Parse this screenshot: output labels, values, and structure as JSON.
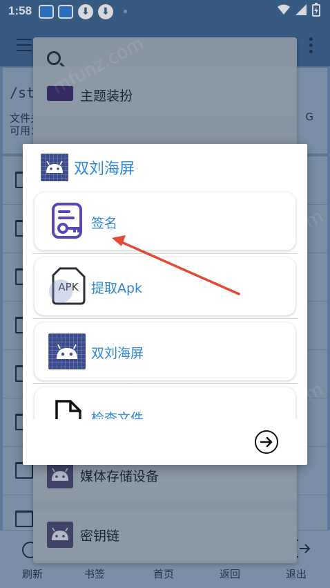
{
  "status": {
    "time": "1:58"
  },
  "path": {
    "text": "/sto",
    "info1": "文件关",
    "info2": "可用：",
    "suffix": "G"
  },
  "menu": {
    "items": [
      {
        "label": "主题装扮"
      },
      {
        "label": "媒体存储设备"
      },
      {
        "label": "密钥链"
      }
    ]
  },
  "dialog": {
    "title": "双刘海屏",
    "options": [
      {
        "label": "签名",
        "icon": "signature-key-icon"
      },
      {
        "label": "提取Apk",
        "icon": "apk-file-icon",
        "icon_text": "APK"
      },
      {
        "label": "双刘海屏",
        "icon": "android-icon"
      },
      {
        "label": "检查文件",
        "icon": "file-outline-icon"
      }
    ],
    "next_icon": "arrow-right-circle-icon"
  },
  "nav": {
    "items": [
      {
        "label": "刷新"
      },
      {
        "label": "书签"
      },
      {
        "label": "首页"
      },
      {
        "label": "返回"
      },
      {
        "label": "退出"
      }
    ]
  },
  "colors": {
    "accent": "#2d86d6",
    "appbar": "#3d6690",
    "signature_icon": "#5b46b8",
    "android_icon_bg": "#3b4b8c",
    "arrow": "#e34a35"
  },
  "watermark": "mfunz.com"
}
